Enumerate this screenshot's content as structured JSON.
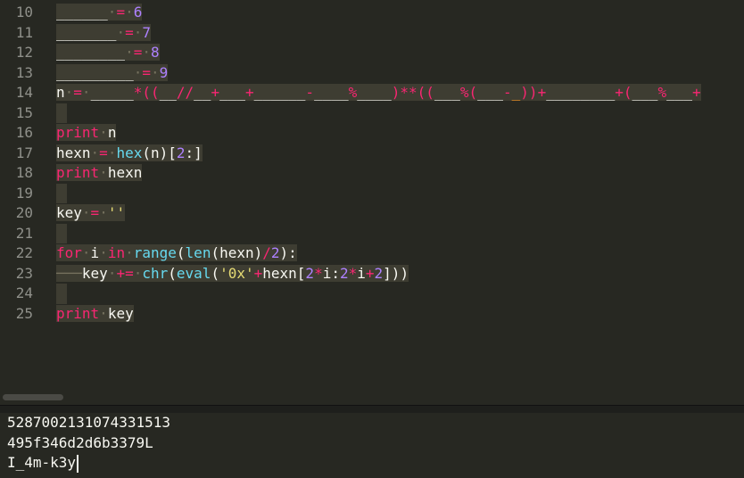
{
  "editor": {
    "line_numbers": [
      "10",
      "11",
      "12",
      "13",
      "14",
      "15",
      "16",
      "17",
      "18",
      "19",
      "20",
      "21",
      "22",
      "23",
      "24",
      "25"
    ],
    "lines": {
      "l10": {
        "a": "______",
        "b": "=",
        "c": "6"
      },
      "l11": {
        "a": "_______",
        "b": "=",
        "c": "7"
      },
      "l12": {
        "a": "________",
        "b": "=",
        "c": "8"
      },
      "l13": {
        "a": "_________",
        "b": "=",
        "c": "9"
      },
      "l14": {
        "p1": "n",
        "p2": "=",
        "p3": "_____",
        "p4": "*((",
        "p5": "__",
        "p6": "//",
        "p7": "__",
        "p8": "+",
        "p9": "___",
        "p10": "+",
        "p11": "______",
        "p12": "-",
        "p13": "____",
        "p14": "%",
        "p15": "____",
        "p16": ")**((",
        "p17": "___",
        "p18": "%(",
        "p19": "___",
        "p20": "-",
        "p21": "_",
        "p22": "))",
        "p23": "+",
        "p24": "________",
        "p25": "+(",
        "p26": "___",
        "p27": "%",
        "p28": "___",
        "p29": "+"
      },
      "l16": {
        "kw": "print",
        "id": "n"
      },
      "l17": {
        "id": "hexn",
        "op": "=",
        "fn": "hex",
        "rest1": "(n)[",
        "num": "2",
        "rest2": ":]"
      },
      "l18": {
        "kw": "print",
        "id": "hexn"
      },
      "l20": {
        "id": "key",
        "op": "=",
        "str": "''"
      },
      "l22": {
        "kw1": "for",
        "id1": "i",
        "kw2": "in",
        "fn1": "range",
        "p1": "(",
        "fn2": "len",
        "p2": "(hexn)",
        "op": "/",
        "num": "2",
        "p3": "):"
      },
      "l23": {
        "id": "key",
        "op": "+=",
        "fn1": "chr",
        "p1": "(",
        "fn2": "eval",
        "p2": "(",
        "str": "'0x'",
        "op2": "+",
        "id2": "hexn[",
        "n1": "2",
        "op3": "*",
        "id3": "i:",
        "n2": "2",
        "op4": "*",
        "id4": "i",
        "op5": "+",
        "n3": "2",
        "p3": "]))"
      },
      "l25": {
        "kw": "print",
        "id": "key"
      }
    }
  },
  "console": {
    "output": [
      "5287002131074331513",
      "495f346d2d6b3379L",
      "I_4m-k3y"
    ]
  }
}
